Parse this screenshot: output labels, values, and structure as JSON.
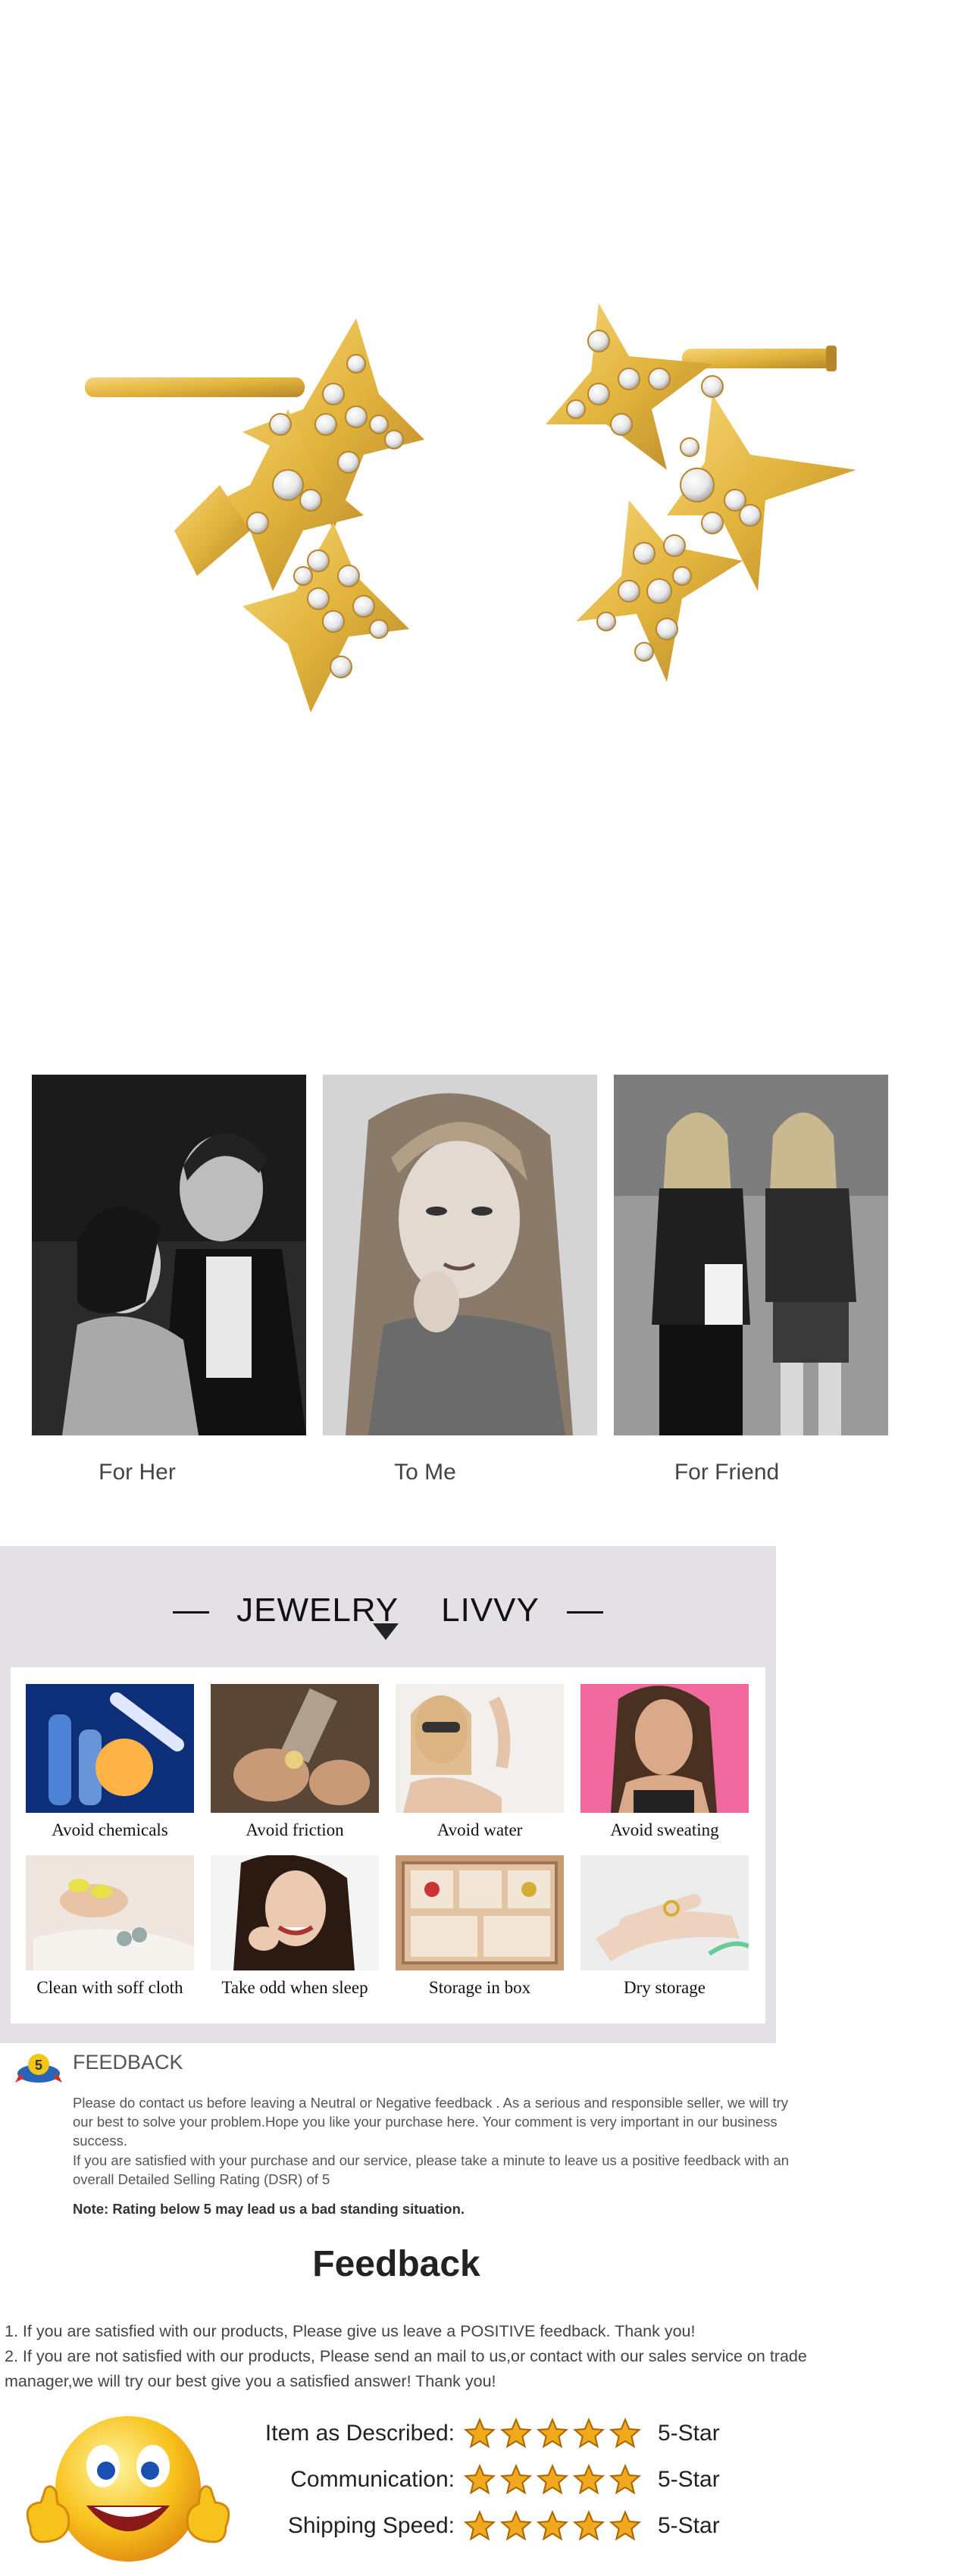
{
  "product": {
    "image_name": "gold-star-cz-stud-earrings"
  },
  "gifts": {
    "items": [
      {
        "caption": "For Her"
      },
      {
        "caption": "To Me"
      },
      {
        "caption": "For Friend"
      }
    ]
  },
  "care": {
    "brand_left": "JEWELRY",
    "brand_right": "LIVVY",
    "items": [
      {
        "label": "Avoid chemicals"
      },
      {
        "label": "Avoid friction"
      },
      {
        "label": "Avoid water"
      },
      {
        "label": "Avoid sweating"
      },
      {
        "label": "Clean with soff cloth"
      },
      {
        "label": "Take odd when sleep"
      },
      {
        "label": "Storage in box"
      },
      {
        "label": "Dry storage"
      }
    ]
  },
  "feedback": {
    "badge": "5",
    "heading": "FEEDBACK",
    "para1": "Please do contact us before leaving a Neutral or Negative  feedback . As a serious and responsible seller, we will try our best to solve your problem.Hope you like your purchase here. Your comment is very important in our business success.",
    "para2": " If you are satisfied with your purchase and our service,  please take a minute to leave us  a positive feedback with an overall  Detailed Selling Rating (DSR) of 5",
    "note": "Note: Rating below 5 may lead us a bad standing situation.",
    "big_title": "Feedback",
    "line1": "1. If you are satisfied with our products, Please give us leave a POSITIVE feedback. Thank you!",
    "line2": "2. If you are not satisfied with our products, Please send an mail to us,or contact with our sales service on trade manager,we will try our best give you a satisfied answer! Thank you!"
  },
  "ratings": [
    {
      "label": "Item as Described:",
      "value": "5-Star",
      "stars": 5
    },
    {
      "label": "Communication:",
      "value": "5-Star",
      "stars": 5
    },
    {
      "label": "Shipping Speed:",
      "value": "5-Star",
      "stars": 5
    }
  ],
  "colors": {
    "gold": "#e2b43c",
    "panel": "#e4e1e6",
    "star": "#f2a81d"
  }
}
